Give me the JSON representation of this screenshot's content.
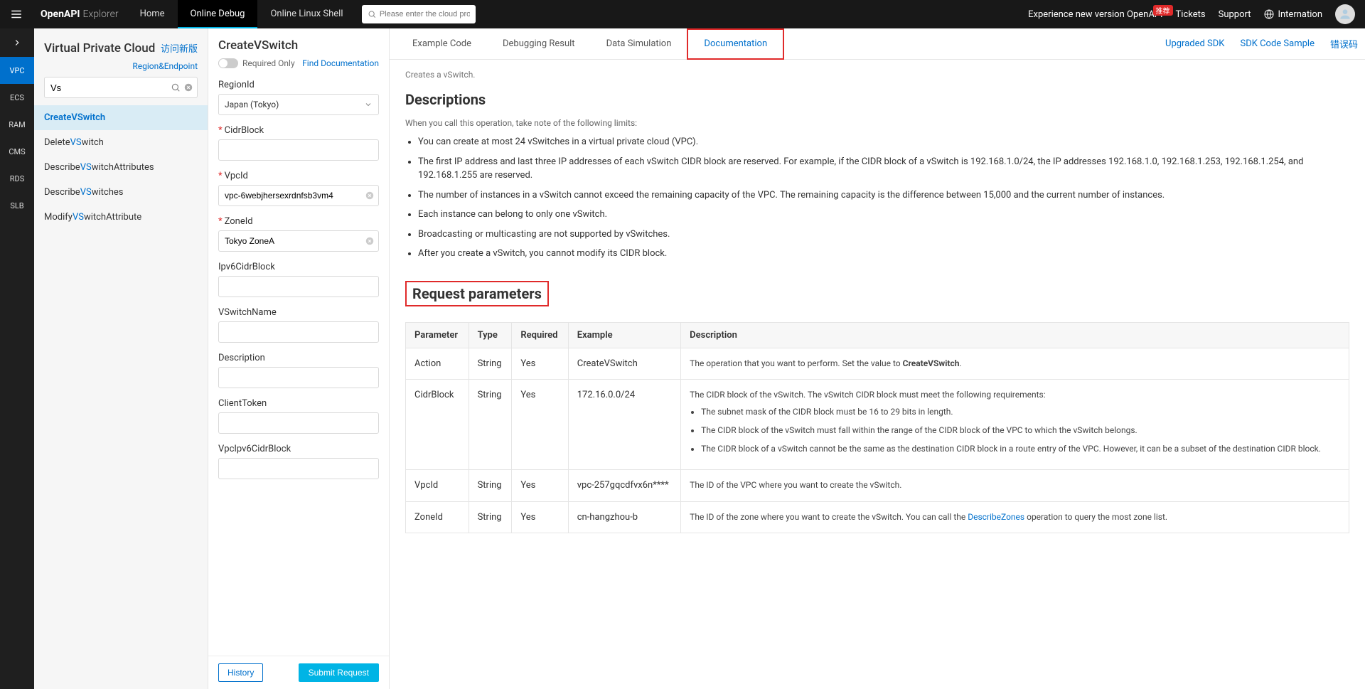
{
  "header": {
    "logo_bold": "OpenAPI",
    "logo_thin": "Explorer",
    "tabs": [
      "Home",
      "Online Debug",
      "Online Linux Shell"
    ],
    "active_tab": 1,
    "search_placeholder": "Please enter the cloud product",
    "right": {
      "new_ver": "Experience new version OpenAPI",
      "badge": "推荐",
      "tickets": "Tickets",
      "support": "Support",
      "intl": "Internation"
    }
  },
  "mini_sidebar": {
    "items": [
      "VPC",
      "ECS",
      "RAM",
      "CMS",
      "RDS",
      "SLB"
    ],
    "active": 0
  },
  "api_sidebar": {
    "title": "Virtual Private Cloud",
    "title_link": "访问新版",
    "region_link": "Region&Endpoint",
    "search_value": "Vs",
    "items": [
      {
        "pre": "Create",
        "hl": "VS",
        "post": "witch",
        "active": true
      },
      {
        "pre": "Delete",
        "hl": "VS",
        "post": "witch",
        "active": false
      },
      {
        "pre": "Describe",
        "hl": "VS",
        "post": "witchAttributes",
        "active": false
      },
      {
        "pre": "Describe",
        "hl": "VS",
        "post": "witches",
        "active": false
      },
      {
        "pre": "Modify",
        "hl": "VS",
        "post": "witchAttribute",
        "active": false
      }
    ]
  },
  "params": {
    "title": "CreateVSwitch",
    "required_only": "Required Only",
    "find_doc": "Find Documentation",
    "fields": {
      "region": {
        "label": "RegionId",
        "value": "Japan (Tokyo)",
        "required": false
      },
      "cidr": {
        "label": "CidrBlock",
        "value": "",
        "required": true
      },
      "vpcid": {
        "label": "VpcId",
        "value": "vpc-6webjhersexrdnfsb3vm4",
        "required": true
      },
      "zoneid": {
        "label": "ZoneId",
        "value": "Tokyo ZoneA",
        "required": true
      },
      "ipv6cidr": {
        "label": "Ipv6CidrBlock",
        "value": "",
        "required": false
      },
      "vswitchname": {
        "label": "VSwitchName",
        "value": "",
        "required": false
      },
      "description": {
        "label": "Description",
        "value": "",
        "required": false
      },
      "clienttoken": {
        "label": "ClientToken",
        "value": "",
        "required": false
      },
      "vpcipv6cidr": {
        "label": "VpcIpv6CidrBlock",
        "value": "",
        "required": false
      }
    },
    "history": "History",
    "submit": "Submit Request"
  },
  "content": {
    "tabs": [
      "Example Code",
      "Debugging Result",
      "Data Simulation",
      "Documentation"
    ],
    "active": 3,
    "links": [
      "Upgraded SDK",
      "SDK Code Sample",
      "错误码"
    ],
    "intro": "Creates a vSwitch.",
    "h_desc": "Descriptions",
    "desc_note": "When you call this operation, take note of the following limits:",
    "bullets": [
      "You can create at most 24 vSwitches in a virtual private cloud (VPC).",
      "The first IP address and last three IP addresses of each vSwitch CIDR block are reserved. For example, if the CIDR block of a vSwitch is 192.168.1.0/24, the IP addresses 192.168.1.0, 192.168.1.253, 192.168.1.254, and 192.168.1.255 are reserved.",
      "The number of instances in a vSwitch cannot exceed the remaining capacity of the VPC. The remaining capacity is the difference between 15,000 and the current number of instances.",
      "Each instance can belong to only one vSwitch.",
      "Broadcasting or multicasting are not supported by vSwitches.",
      "After you create a vSwitch, you cannot modify its CIDR block."
    ],
    "h_req": "Request parameters",
    "table": {
      "headers": [
        "Parameter",
        "Type",
        "Required",
        "Example",
        "Description"
      ],
      "rows": [
        {
          "param": "Action",
          "type": "String",
          "required": "Yes",
          "example": "CreateVSwitch",
          "desc_pre": "The operation that you want to perform. Set the value to ",
          "desc_bold": "CreateVSwitch",
          "desc_post": "."
        },
        {
          "param": "CidrBlock",
          "type": "String",
          "required": "Yes",
          "example": "172.16.0.0/24",
          "desc_intro": "The CIDR block of the vSwitch. The vSwitch CIDR block must meet the following requirements:",
          "bullets": [
            "The subnet mask of the CIDR block must be 16 to 29 bits in length.",
            "The CIDR block of the vSwitch must fall within the range of the CIDR block of the VPC to which the vSwitch belongs.",
            "The CIDR block of a vSwitch cannot be the same as the destination CIDR block in a route entry of the VPC. However, it can be a subset of the destination CIDR block."
          ]
        },
        {
          "param": "VpcId",
          "type": "String",
          "required": "Yes",
          "example": "vpc-257gqcdfvx6n****",
          "desc_plain": "The ID of the VPC where you want to create the vSwitch."
        },
        {
          "param": "ZoneId",
          "type": "String",
          "required": "Yes",
          "example": "cn-hangzhou-b",
          "desc_pre2": "The ID of the zone where you want to create the vSwitch. You can call the ",
          "desc_link": "DescribeZones",
          "desc_post2": " operation to query the most zone list."
        }
      ]
    }
  }
}
